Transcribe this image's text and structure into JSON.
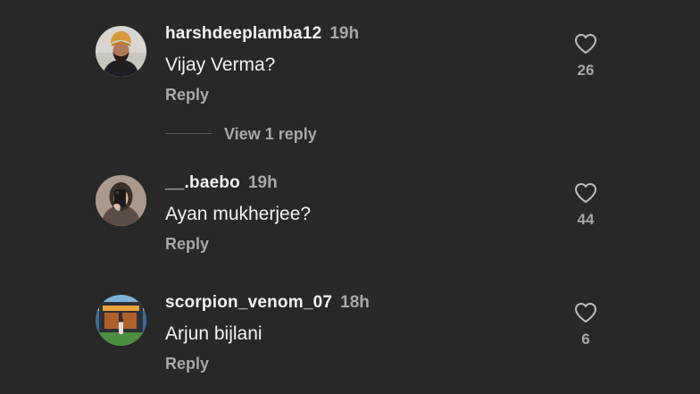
{
  "comments": [
    {
      "username": "harshdeeplamba12",
      "time": "19h",
      "text": "Vijay Verma?",
      "reply_label": "Reply",
      "likes": "26",
      "avatar_icon": "profile-photo-man-turban",
      "view_replies_label": "View 1 reply"
    },
    {
      "username": "__.baebo",
      "time": "19h",
      "text": "Ayan mukherjee?",
      "reply_label": "Reply",
      "likes": "44",
      "avatar_icon": "profile-photo-mirror-selfie"
    },
    {
      "username": "scorpion_venom_07",
      "time": "18h",
      "text": "Arjun bijlani",
      "reply_label": "Reply",
      "likes": "6",
      "avatar_icon": "profile-photo-storefront"
    }
  ],
  "colors": {
    "background": "#282828",
    "primary_text": "#f2f2f2",
    "secondary_text": "#a8a8a8",
    "divider": "#5a5a5a"
  }
}
